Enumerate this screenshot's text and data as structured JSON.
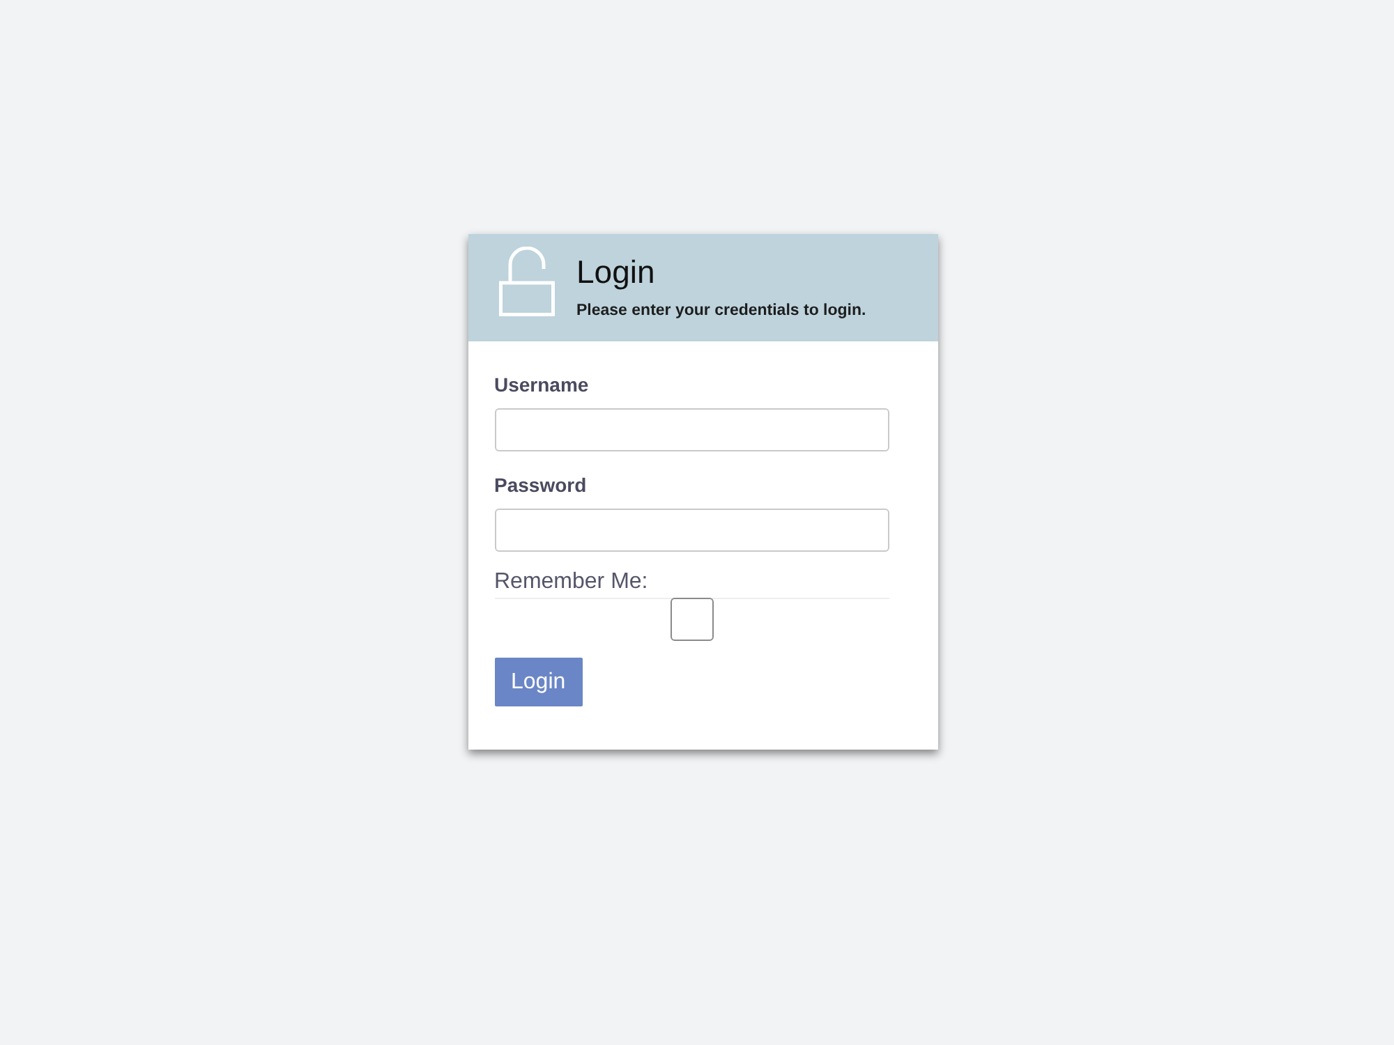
{
  "header": {
    "title": "Login",
    "subtitle": "Please enter your credentials to login."
  },
  "fields": [
    {
      "label": "Username"
    },
    {
      "label": "Password"
    }
  ],
  "remember": {
    "label": "Remember Me:",
    "checked": false
  },
  "button": {
    "label": "Login"
  }
}
